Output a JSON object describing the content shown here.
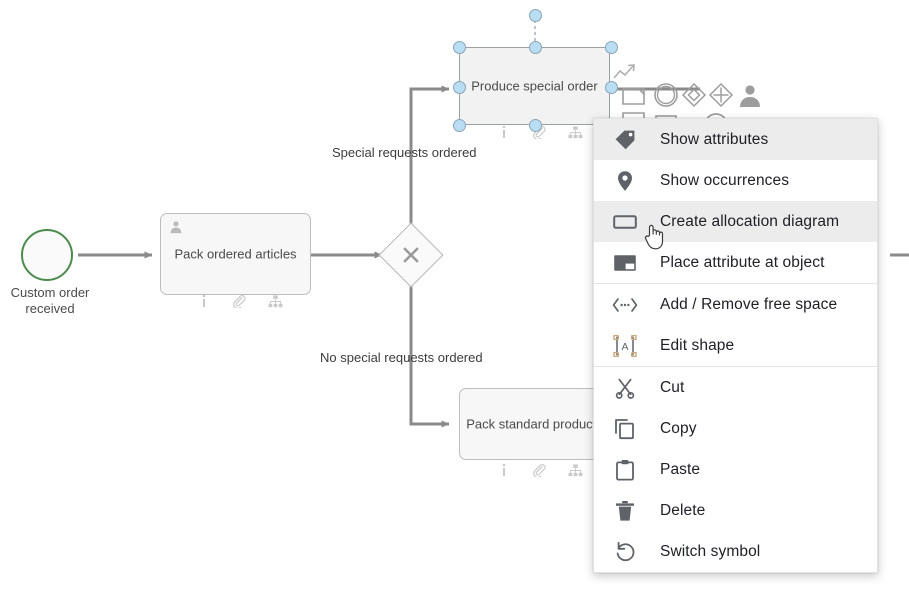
{
  "canvas": {
    "background_color": "#ffffff",
    "nodes": [
      {
        "id": "start-event",
        "type": "start-event",
        "label": "Custom order\nreceived",
        "label_line1": "Custom order",
        "label_line2": "received",
        "border_color": "#4b8b4b"
      },
      {
        "id": "pack-ordered-articles",
        "type": "task",
        "label": "Pack ordered articles",
        "adornment_icons": [
          "info-icon",
          "paperclip-icon",
          "hierarchy-icon"
        ],
        "role_icon": "person-icon"
      },
      {
        "id": "exclusive-gateway",
        "type": "exclusive-gateway",
        "label": "",
        "symbol": "x-mark-icon"
      },
      {
        "id": "produce-special-order",
        "type": "task",
        "label": "Produce special order",
        "selected": true,
        "adornment_icons": [
          "info-icon",
          "paperclip-icon",
          "hierarchy-icon"
        ],
        "role_icon": "person-icon"
      },
      {
        "id": "pack-standard-products",
        "type": "task",
        "label": "Pack standard products",
        "adornment_icons": [
          "info-icon",
          "paperclip-icon",
          "hierarchy-icon"
        ]
      }
    ],
    "edge_labels": [
      {
        "id": "special",
        "text": "Special requests ordered"
      },
      {
        "id": "no-special",
        "text": "No special requests ordered"
      }
    ],
    "mini_toolbar": {
      "icons": [
        "trend-arrow-icon",
        "task-shape-icon",
        "event-circle-icon",
        "gateway-diamond-icon",
        "gateway-plus-icon",
        "person-shape-icon",
        "subprocess-shape-icon",
        "data-shape-icon",
        "end-event-icon"
      ]
    }
  },
  "context_menu": {
    "items": [
      {
        "label": "Show attributes",
        "icon": "tag-icon",
        "highlighted": true,
        "separator_after": false
      },
      {
        "label": "Show occurrences",
        "icon": "location-pin-icon",
        "highlighted": false,
        "separator_after": false
      },
      {
        "label": "Create allocation diagram",
        "icon": "rectangle-icon",
        "highlighted": true,
        "separator_after": false
      },
      {
        "label": "Place attribute at object",
        "icon": "attribute-icon",
        "highlighted": false,
        "separator_after": true
      },
      {
        "label": "Add / Remove free space",
        "icon": "free-space-icon",
        "highlighted": false,
        "separator_after": false
      },
      {
        "label": "Edit shape",
        "icon": "edit-shape-icon",
        "highlighted": false,
        "separator_after": true
      },
      {
        "label": "Cut",
        "icon": "scissors-icon",
        "highlighted": false,
        "separator_after": false
      },
      {
        "label": "Copy",
        "icon": "copy-icon",
        "highlighted": false,
        "separator_after": false
      },
      {
        "label": "Paste",
        "icon": "clipboard-icon",
        "highlighted": false,
        "separator_after": false
      },
      {
        "label": "Delete",
        "icon": "trash-icon",
        "highlighted": false,
        "separator_after": false
      },
      {
        "label": "Switch symbol",
        "icon": "undo-arrow-icon",
        "highlighted": false,
        "separator_after": false
      }
    ],
    "highlight_color": "#ececec",
    "text_color": "#202124",
    "icon_color": "#5f6368"
  },
  "cursor": {
    "type": "pointing-hand-cursor"
  }
}
